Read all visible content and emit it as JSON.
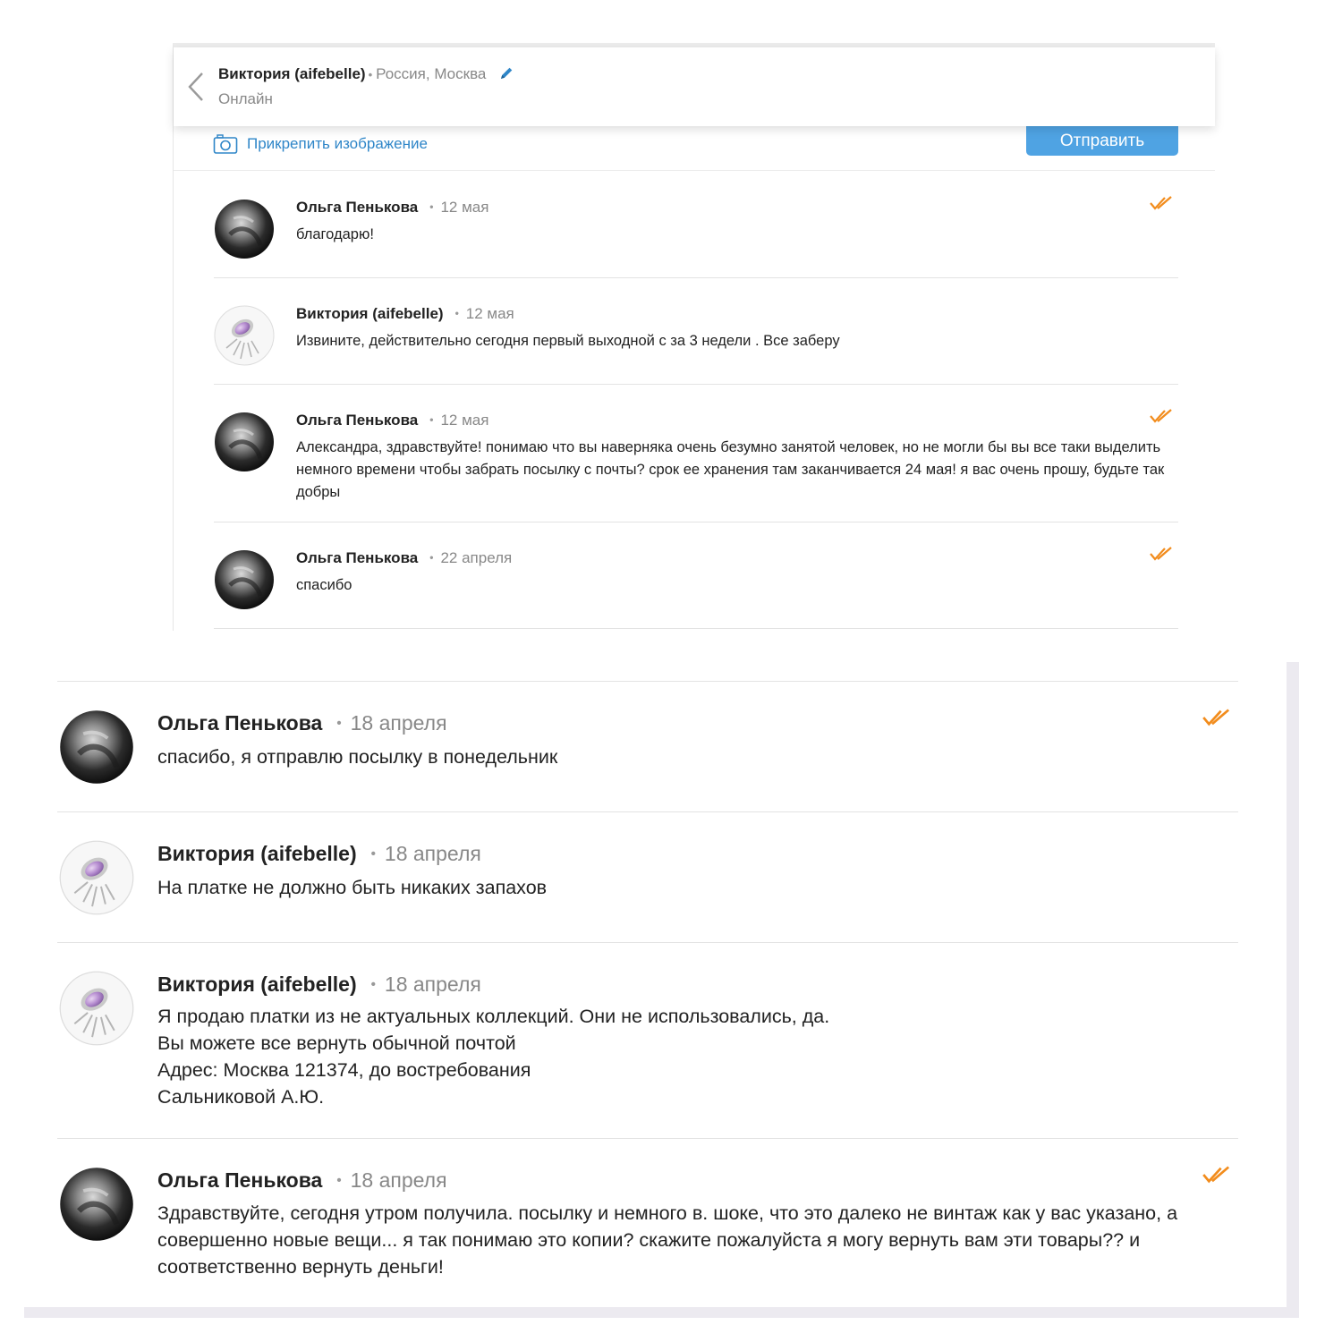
{
  "colors": {
    "accent": "#2f86c8",
    "send_button": "#4fa3e3",
    "read_check": "#f28c1c"
  },
  "header": {
    "name": "Виктория (aifebelle)",
    "location": "Россия, Москва",
    "status": "Онлайн",
    "icons": [
      "chevron-left-icon",
      "pencil-icon"
    ]
  },
  "composer": {
    "attach_label": "Прикрепить изображение",
    "send_label": "Отправить",
    "icons": [
      "camera-icon"
    ]
  },
  "messages_top": [
    {
      "author": "Ольга Penькова",
      "date": "12 мая",
      "text": "благодарю!",
      "read": true
    },
    {
      "author": "Виктория (aifebelle)",
      "date": "12 мая",
      "text": "Извините, действительно сегодня первый выходной с за 3 недели . Все заберу",
      "read": false
    },
    {
      "author": "Ольга Penькова",
      "date": "12 мая",
      "text": "Александра, здравствуйте! понимаю что вы наверняка очень безумно занятой человек, но не могли бы вы все таки выделить немного времени чтобы забрать посылку с почты? срок ее хранения там заканчивается 24 мая! я вас очень прошу, будьте так добры",
      "read": true
    },
    {
      "author": "Ольга Penькова",
      "date": "22 апреля",
      "text": "спасибо",
      "read": true
    }
  ],
  "messages_bottom": [
    {
      "author": "Ольга Penькова",
      "date": "18 апреля",
      "text": "спасибо, я отправлю посылку в понедельник",
      "read": true
    },
    {
      "author": "Виктория (aifebelle)",
      "date": "18 апреля",
      "text": "На платке не должно быть никаких запахов",
      "read": false
    },
    {
      "author": "Виктория (aifebelle)",
      "date": "18 апреля",
      "text": "Я продаю платки из не актуальных коллекций. Они не использовались, да.\nВы можете все вернуть обычной почтой\nАдрес: Москва 121374, до востребования\nСальниковой А.Ю.",
      "read": false
    },
    {
      "author": "Ольга Penькова",
      "date": "18 апреля",
      "text": "Здравствуйте, сегодня утром получила. посылку и немного в. шоке, что это далеко не винтаж как у вас указано, а совершенно новые вещи... я так понимаю это копии? скажите пожалуйста я могу вернуть вам эти товары?? и соответственно вернуть деньги!",
      "read": true
    }
  ]
}
